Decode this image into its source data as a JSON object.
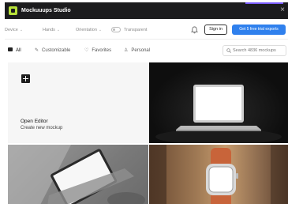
{
  "window": {
    "title": "Mockuuups Studio"
  },
  "toolbar": {
    "device": "Device",
    "hands": "Hands",
    "orientation": "Orientation",
    "transparent": "Transparent",
    "signin": "Sign in",
    "cta": "Get 5 free trial exports"
  },
  "filters": {
    "all": "All",
    "customizable": "Customizable",
    "favorites": "Favorites",
    "personal": "Personal",
    "search_placeholder": "Search 4836 mockups"
  },
  "grid": {
    "editor_title": "Open Editor",
    "editor_subtitle": "Create new mockup"
  },
  "colors": {
    "titlebar": "#1c1c1e",
    "logo": "#b8e23a",
    "cta": "#2f80ed",
    "accent": "#7a5cff"
  }
}
